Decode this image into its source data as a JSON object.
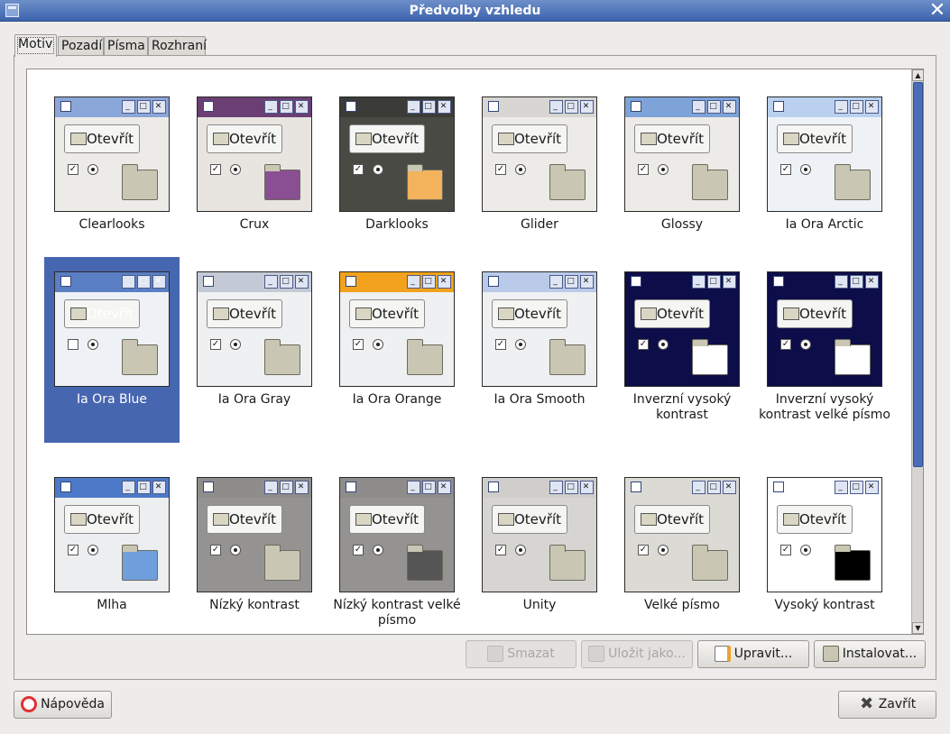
{
  "window": {
    "title": "Předvolby vzhledu",
    "close_glyph": "✕"
  },
  "tabs": [
    {
      "label": "Motiv",
      "active": true
    },
    {
      "label": "Pozadí",
      "active": false
    },
    {
      "label": "Písma",
      "active": false
    },
    {
      "label": "Rozhraní",
      "active": false
    }
  ],
  "preview": {
    "button_label": "Otevřít"
  },
  "themes": [
    {
      "name": "Clearlooks",
      "bg": "#edebe7",
      "bar": "#8ba6d9",
      "folder": "#c9c7b3"
    },
    {
      "name": "Crux",
      "bg": "#e8e4e0",
      "bar": "#6b3f73",
      "folder": "#8a4f93"
    },
    {
      "name": "Darklooks",
      "bg": "#4a4a45",
      "bar": "#3b3b38",
      "folder": "#f2b35c"
    },
    {
      "name": "Glider",
      "bg": "#edebe7",
      "bar": "#d8d6d2",
      "folder": "#c9c7b3"
    },
    {
      "name": "Glossy",
      "bg": "#edebe7",
      "bar": "#7ea3d8",
      "folder": "#c9c7b3"
    },
    {
      "name": "Ia Ora Arctic",
      "bg": "#eef2f7",
      "bar": "#b9d1ef",
      "folder": "#c9c7b3"
    },
    {
      "name": "Ia Ora Blue",
      "bg": "#eef2f7",
      "bar": "#5b7fc4",
      "folder": "#c9c7b3"
    },
    {
      "name": "Ia Ora Gray",
      "bg": "#eef0f2",
      "bar": "#c4cad5",
      "folder": "#c9c7b3"
    },
    {
      "name": "Ia Ora Orange",
      "bg": "#eef0f2",
      "bar": "#f2a21c",
      "folder": "#c9c7b3"
    },
    {
      "name": "Ia Ora Smooth",
      "bg": "#eef0f2",
      "bar": "#b9cbe8",
      "folder": "#c9c7b3"
    },
    {
      "name": "Inverzní vysoký kontrast",
      "bg": "#0d0d4a",
      "bar": "#0d0d4a",
      "folder": "#ffffff"
    },
    {
      "name": "Inverzní vysoký kontrast velké písmo",
      "bg": "#0d0d4a",
      "bar": "#0d0d4a",
      "folder": "#ffffff"
    },
    {
      "name": "Mlha",
      "bg": "#edeef0",
      "bar": "#4d7ac8",
      "folder": "#6f9fdc"
    },
    {
      "name": "Nízký kontrast",
      "bg": "#949391",
      "bar": "#8e8d8b",
      "folder": "#c9c7b3"
    },
    {
      "name": "Nízký kontrast velké písmo",
      "bg": "#949391",
      "bar": "#8e8d8b",
      "folder": "#555555"
    },
    {
      "name": "Unity",
      "bg": "#d7d5d2",
      "bar": "#d0cecb",
      "folder": "#c9c7b3"
    },
    {
      "name": "Velké písmo",
      "bg": "#dcdad5",
      "bar": "#dcdad5",
      "folder": "#c9c7b3"
    },
    {
      "name": "Vysoký kontrast",
      "bg": "#ffffff",
      "bar": "#ffffff",
      "folder": "#000000"
    }
  ],
  "actions": {
    "delete": "Smazat",
    "save_as": "Uložit jako...",
    "edit": "Upravit...",
    "install": "Instalovat..."
  },
  "footer": {
    "help": "Nápověda",
    "close": "Zavřít"
  }
}
